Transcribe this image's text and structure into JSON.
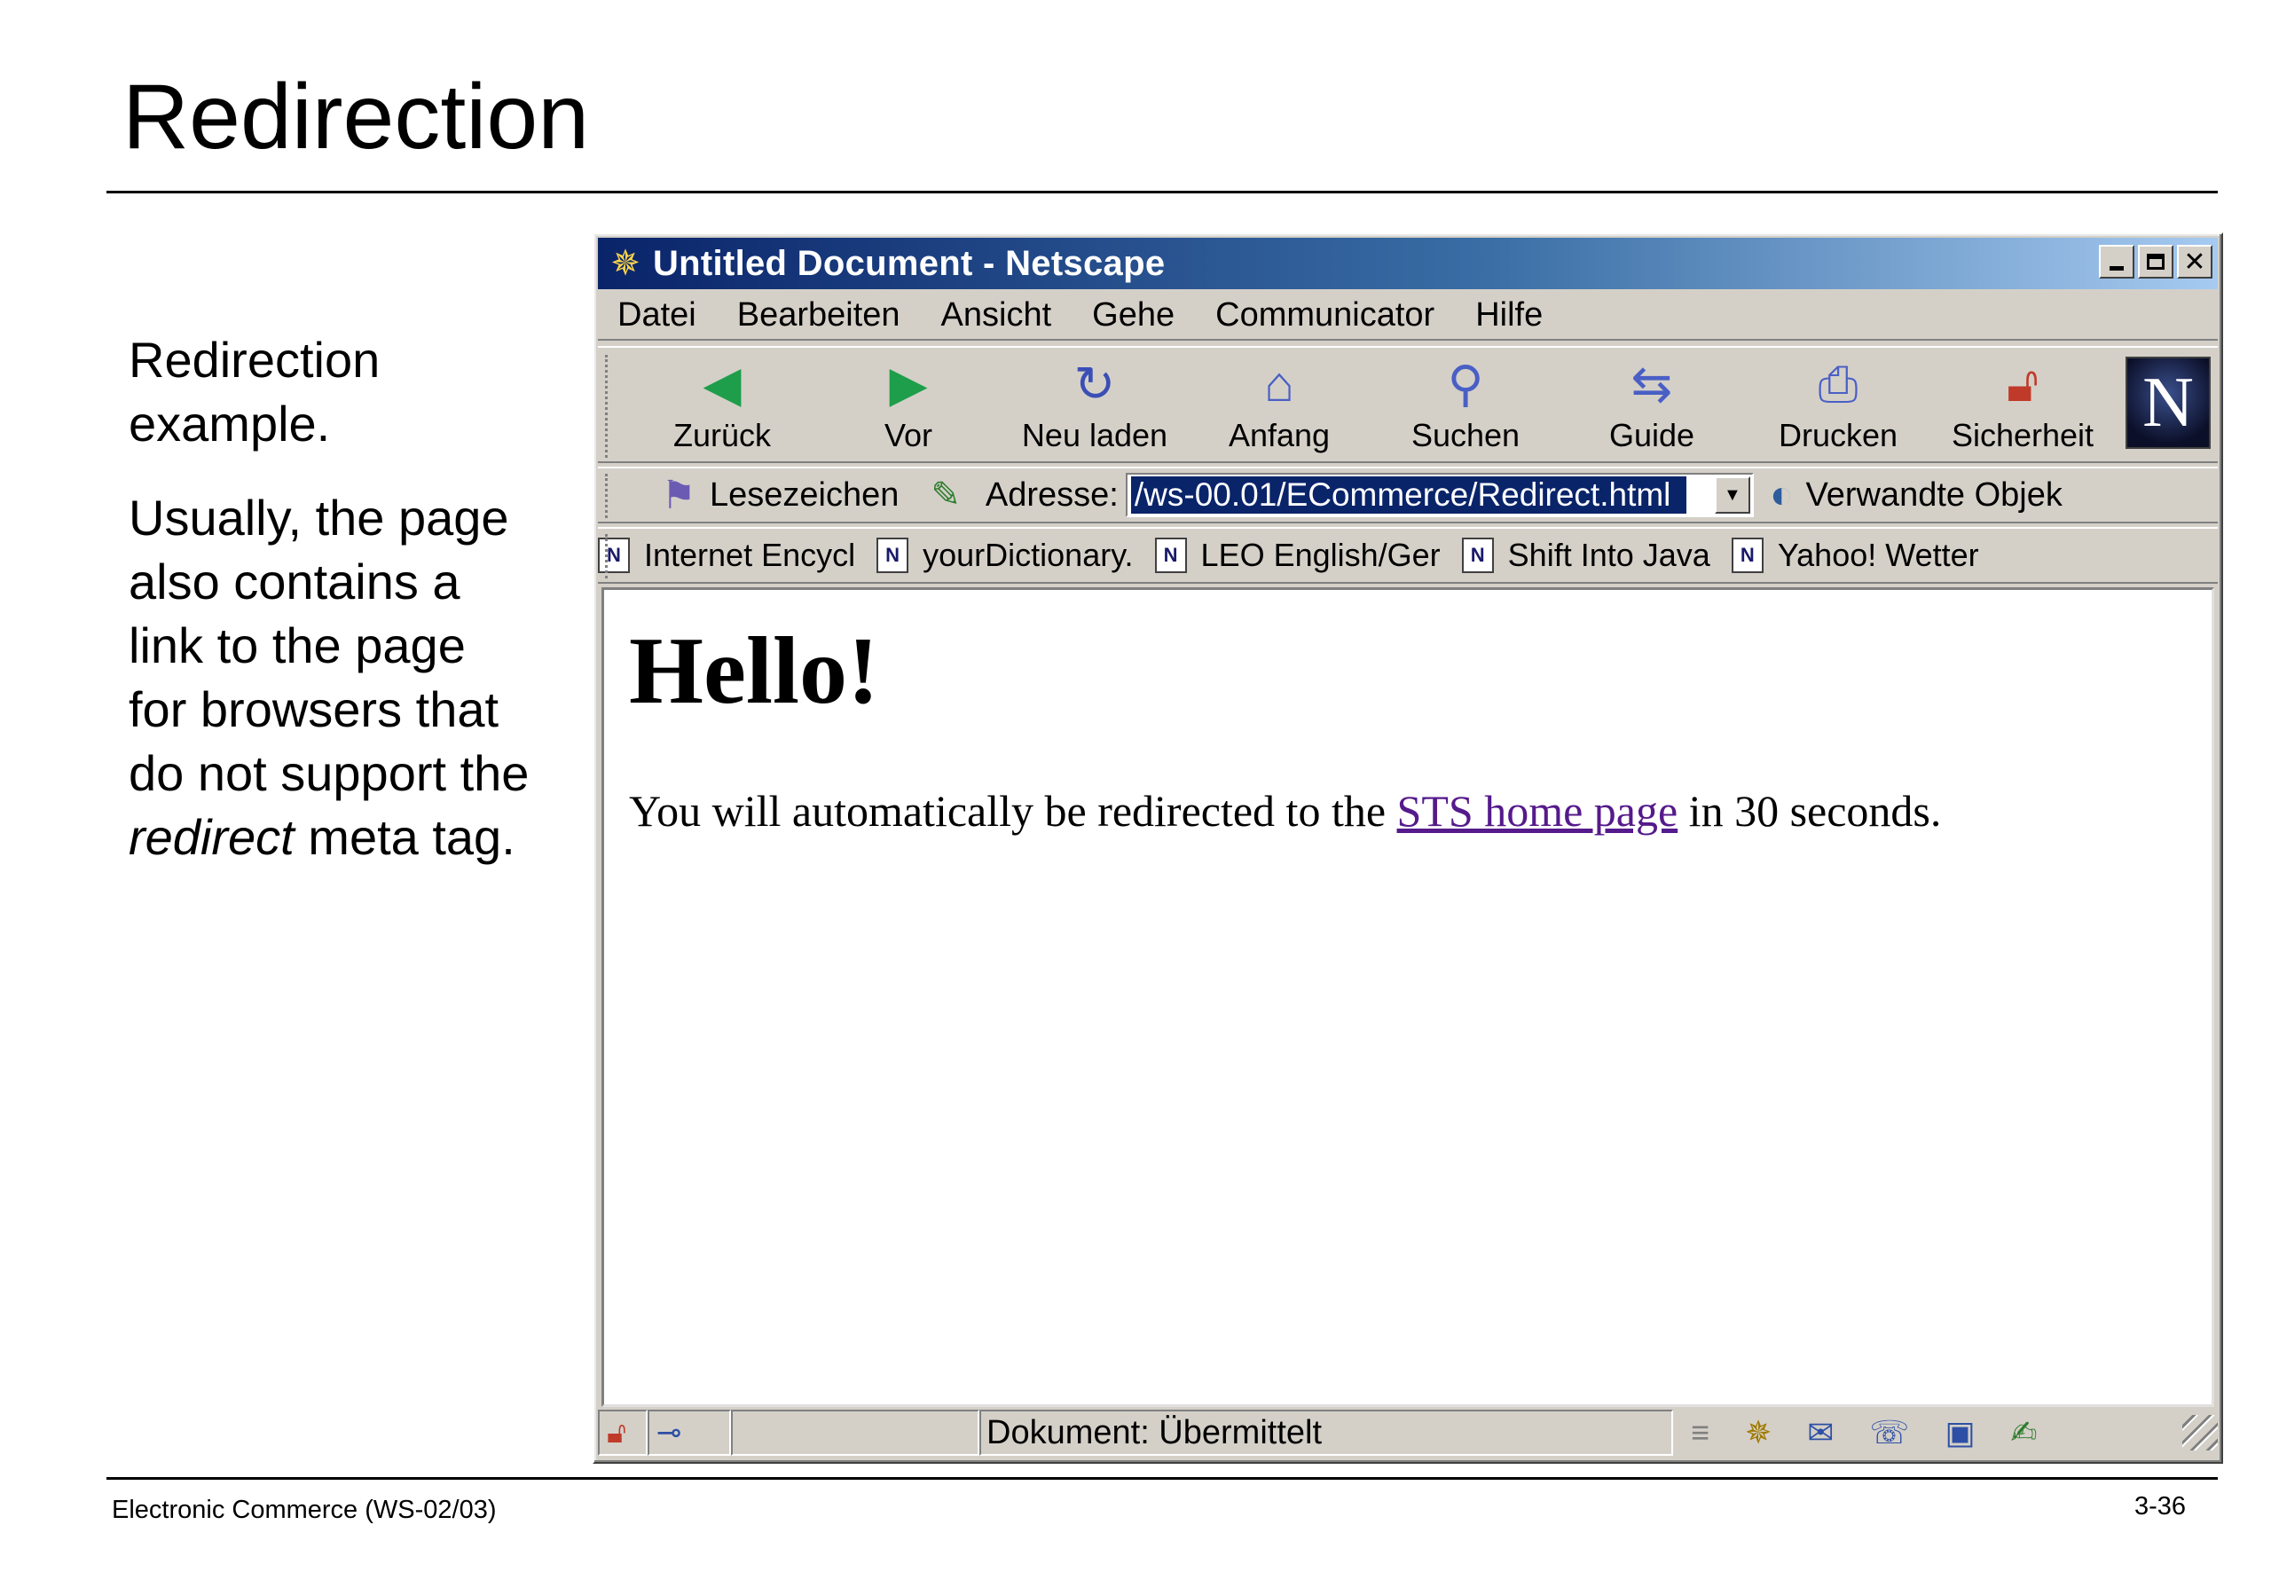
{
  "slide": {
    "title": "Redirection",
    "paragraph1": "Redirection example.",
    "paragraph2_pre": "Usually, the page also contains a link to the page for browsers that do not support the ",
    "paragraph2_em": "redirect",
    "paragraph2_post": " meta tag.",
    "footer_left": "Electronic Commerce (WS-02/03)",
    "footer_right": "3-36"
  },
  "window": {
    "title": "Untitled Document - Netscape",
    "menu": [
      "Datei",
      "Bearbeiten",
      "Ansicht",
      "Gehe",
      "Communicator",
      "Hilfe"
    ],
    "toolbar": [
      {
        "label": "Zurück",
        "icon": "back-arrow-icon"
      },
      {
        "label": "Vor",
        "icon": "forward-arrow-icon"
      },
      {
        "label": "Neu laden",
        "icon": "reload-icon"
      },
      {
        "label": "Anfang",
        "icon": "home-icon"
      },
      {
        "label": "Suchen",
        "icon": "search-icon"
      },
      {
        "label": "Guide",
        "icon": "guide-icon"
      },
      {
        "label": "Drucken",
        "icon": "print-icon"
      },
      {
        "label": "Sicherheit",
        "icon": "lock-icon"
      }
    ],
    "logo_letter": "N",
    "location": {
      "bookmarks_label": "Lesezeichen",
      "address_label": "Adresse:",
      "address_value": "/ws-00.01/ECommerce/Redirect.html",
      "related_label": "Verwandte Objek"
    },
    "bookmarks": [
      "Internet Encycl",
      "yourDictionary.",
      "LEO English/Ger",
      "Shift Into Java",
      "Yahoo! Wetter"
    ],
    "content": {
      "heading": "Hello!",
      "text_pre": "You will automatically be redirected to the ",
      "link": "STS home page",
      "text_post": " in 30 seconds."
    },
    "status": "Dokument: Übermittelt",
    "colors": {
      "titlebar_start": "#0a246a",
      "titlebar_end": "#a6caf0",
      "chrome": "#d4d0c8",
      "link_visited": "#551a8b"
    }
  }
}
